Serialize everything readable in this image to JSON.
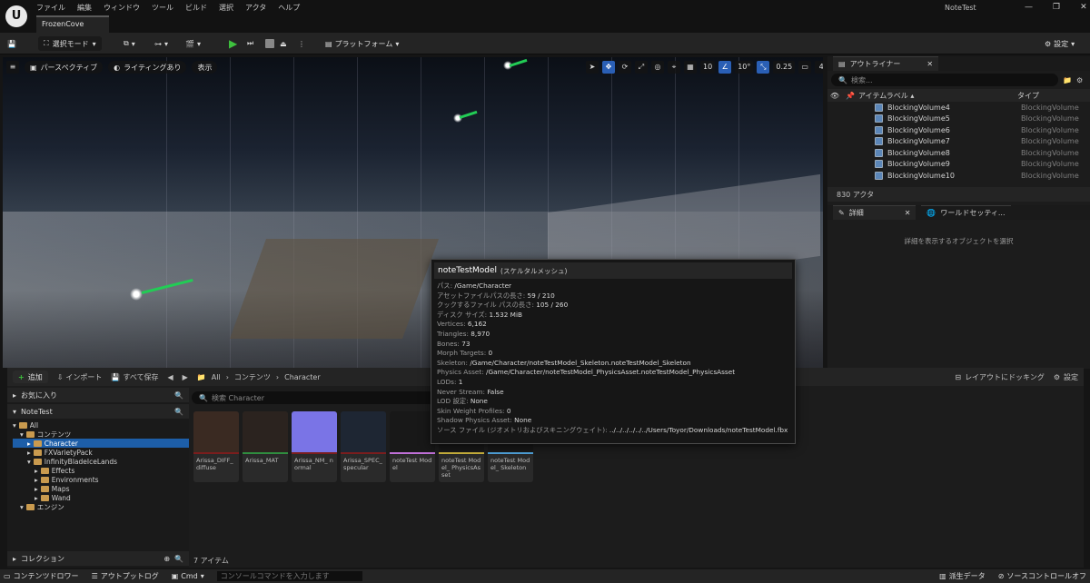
{
  "app": {
    "tab": "FrozenCove",
    "project": "NoteTest",
    "logo": "U"
  },
  "menu": [
    "ファイル",
    "編集",
    "ウィンドウ",
    "ツール",
    "ビルド",
    "選択",
    "アクタ",
    "ヘルプ"
  ],
  "toolbar": {
    "select_mode": "選択モード",
    "platform": "プラットフォーム",
    "settings": "設定"
  },
  "viewport": {
    "perspective": "パースペクティブ",
    "lighting": "ライティングあり",
    "show": "表示",
    "grid_size": "10",
    "rotation": "10°",
    "scale": "0.25",
    "camera_speed": "4"
  },
  "outliner": {
    "title": "アウトライナー",
    "search_placeholder": "検索...",
    "col_label": "アイテムラベル",
    "col_type": "タイプ",
    "rows": [
      {
        "label": "BlockingVolume4",
        "type": "BlockingVolume"
      },
      {
        "label": "BlockingVolume5",
        "type": "BlockingVolume"
      },
      {
        "label": "BlockingVolume6",
        "type": "BlockingVolume"
      },
      {
        "label": "BlockingVolume7",
        "type": "BlockingVolume"
      },
      {
        "label": "BlockingVolume8",
        "type": "BlockingVolume"
      },
      {
        "label": "BlockingVolume9",
        "type": "BlockingVolume"
      },
      {
        "label": "BlockingVolume10",
        "type": "BlockingVolume"
      }
    ],
    "count": "830 アクタ"
  },
  "details": {
    "tab1": "詳細",
    "tab2": "ワールドセッティ...",
    "empty": "詳細を表示するオブジェクトを選択"
  },
  "content": {
    "add": "追加",
    "import": "インポート",
    "save_all": "すべて保存",
    "path": [
      "All",
      "コンテンツ",
      "Character"
    ],
    "dock": "レイアウトにドッキング",
    "settings": "設定",
    "favorites": "お気に入り",
    "project": "NoteTest",
    "search_placeholder": "検索 Character",
    "collections": "コレクション",
    "item_count": "7 アイテム",
    "tree": [
      {
        "label": "All",
        "depth": 0
      },
      {
        "label": "コンテンツ",
        "depth": 1
      },
      {
        "label": "Character",
        "depth": 2,
        "selected": true
      },
      {
        "label": "FXVarietyPack",
        "depth": 2
      },
      {
        "label": "InfinityBladeIceLands",
        "depth": 2
      },
      {
        "label": "Effects",
        "depth": 3
      },
      {
        "label": "Environments",
        "depth": 3
      },
      {
        "label": "Maps",
        "depth": 3
      },
      {
        "label": "Wand",
        "depth": 3
      },
      {
        "label": "エンジン",
        "depth": 1
      }
    ],
    "assets": [
      {
        "label": "Arissa_DIFF_ diffuse",
        "thumb": "#3a2a22",
        "bar": "#7a1d1d"
      },
      {
        "label": "Arissa_MAT",
        "thumb": "#2b231f",
        "bar": "#2f8d3f"
      },
      {
        "label": "Arissa_NM_ normal",
        "thumb": "#7a74e6",
        "bar": "#7a1d1d"
      },
      {
        "label": "Arissa_SPEC_ specular",
        "thumb": "#1e2633",
        "bar": "#7a1d1d"
      },
      {
        "label": "noteTest Model",
        "thumb": "#181818",
        "bar": "#c070d8"
      },
      {
        "label": "noteTest Model_ PhysicsAsset",
        "thumb": "#181818",
        "bar": "#c8b03c"
      },
      {
        "label": "noteTest Model_ Skeleton",
        "thumb": "#181818",
        "bar": "#4fa0d8"
      }
    ]
  },
  "tooltip": {
    "title": "noteTestModel",
    "subtitle": "(スケルタルメッシュ)",
    "rows": [
      {
        "k": "パス:",
        "v": "/Game/Character"
      },
      {
        "k": "アセットファイルパスの長さ:",
        "v": "59 / 210"
      },
      {
        "k": "クックするファイル パスの長さ:",
        "v": "105 / 260"
      },
      {
        "k": "ディスク サイズ:",
        "v": "1.532 MiB"
      },
      {
        "k": "Vertices:",
        "v": "6,162"
      },
      {
        "k": "Triangles:",
        "v": "8,970"
      },
      {
        "k": "Bones:",
        "v": "73"
      },
      {
        "k": "Morph Targets:",
        "v": "0"
      },
      {
        "k": "Skeleton:",
        "v": "/Game/Character/noteTestModel_Skeleton.noteTestModel_Skeleton"
      },
      {
        "k": "Physics Asset:",
        "v": "/Game/Character/noteTestModel_PhysicsAsset.noteTestModel_PhysicsAsset"
      },
      {
        "k": "LODs:",
        "v": "1"
      },
      {
        "k": "Never Stream:",
        "v": "False"
      },
      {
        "k": "LOD 設定:",
        "v": "None"
      },
      {
        "k": "Skin Weight Profiles:",
        "v": "0"
      },
      {
        "k": "Shadow Physics Asset:",
        "v": "None"
      },
      {
        "k": "ソース ファイル (ジオメトリおよびスキニングウェイト):",
        "v": "../../../../../../Users/Toyor/Downloads/noteTestModel.fbx"
      }
    ]
  },
  "statusbar": {
    "drawer": "コンテンツドロワー",
    "output": "アウトプットログ",
    "cmd": "Cmd",
    "cmd_placeholder": "コンソールコマンドを入力します",
    "derived": "派生データ",
    "source_control": "ソースコントロールオフ"
  }
}
